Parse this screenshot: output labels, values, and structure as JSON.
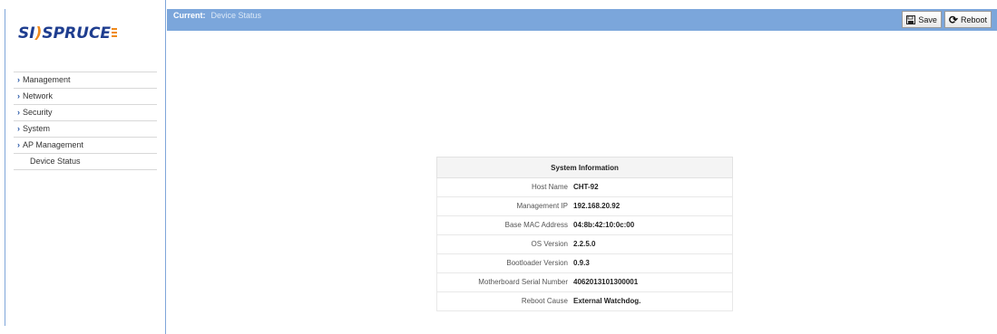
{
  "brand": {
    "logo": "SPRUCE",
    "logo_prefix": "SI",
    "logo_mark": ")"
  },
  "sidebar": {
    "items": [
      {
        "label": "Management",
        "has_chevron": true
      },
      {
        "label": "Network",
        "has_chevron": true
      },
      {
        "label": "Security",
        "has_chevron": true
      },
      {
        "label": "System",
        "has_chevron": true
      },
      {
        "label": "AP Management",
        "has_chevron": true
      },
      {
        "label": "Device Status",
        "has_chevron": false
      }
    ]
  },
  "header": {
    "current_label": "Current:",
    "current_value": "Device Status",
    "save_label": "Save",
    "reboot_label": "Reboot",
    "accent_color": "#7ba6db"
  },
  "system_info": {
    "title": "System Information",
    "rows": [
      {
        "key": "Host Name",
        "value": "CHT-92"
      },
      {
        "key": "Management IP",
        "value": "192.168.20.92"
      },
      {
        "key": "Base MAC Address",
        "value": "04:8b:42:10:0c:00"
      },
      {
        "key": "OS Version",
        "value": "2.2.5.0"
      },
      {
        "key": "Bootloader Version",
        "value": "0.9.3"
      },
      {
        "key": "Motherboard Serial Number",
        "value": "4062013101300001"
      },
      {
        "key": "Reboot Cause",
        "value": "External Watchdog."
      }
    ]
  }
}
